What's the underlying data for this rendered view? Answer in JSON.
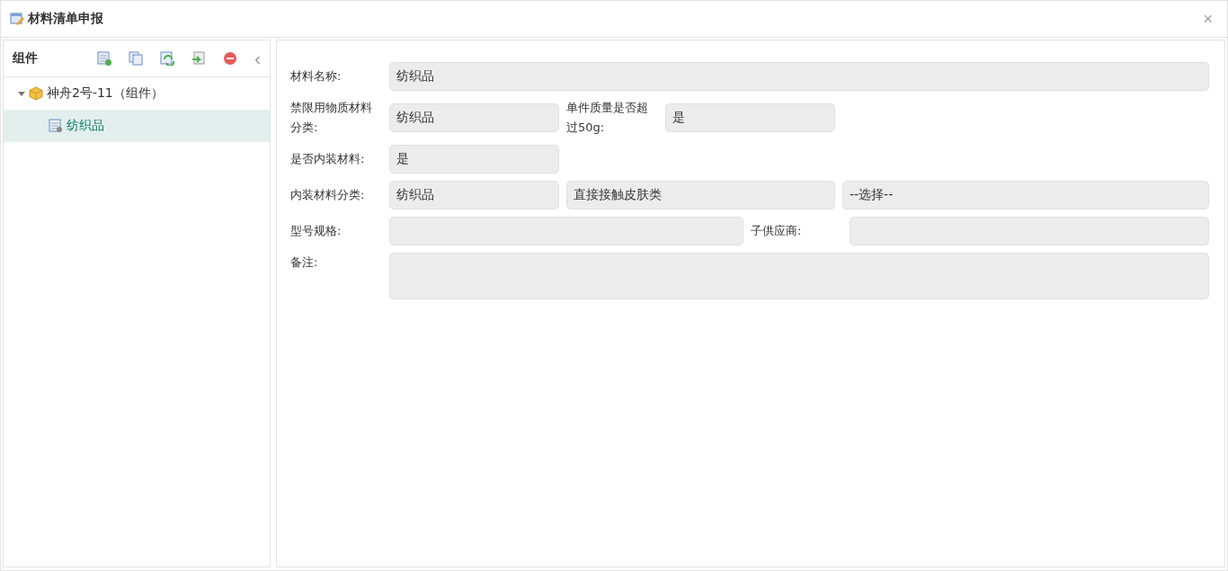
{
  "window": {
    "title": "材料清单申报",
    "close": "×"
  },
  "sidebar": {
    "title": "组件",
    "collapse": "‹",
    "tree": [
      {
        "label": "神舟2号-11（组件）",
        "expanded": true,
        "selected": false,
        "children": [
          {
            "label": "纺织品",
            "selected": true
          }
        ]
      }
    ]
  },
  "form": {
    "material_name": {
      "label": "材料名称:",
      "value": "纺织品"
    },
    "restricted_category": {
      "label": "禁限用物质材料分类:",
      "value": "纺织品"
    },
    "over_50g": {
      "label": "单件质量是否超过50g:",
      "value": "是"
    },
    "inner_material": {
      "label": "是否内装材料:",
      "value": "是"
    },
    "inner_category": {
      "label": "内装材料分类:",
      "values": [
        "纺织品",
        "直接接触皮肤类",
        "--选择--"
      ]
    },
    "model_spec": {
      "label": "型号规格:"
    },
    "sub_supplier": {
      "label": "子供应商:"
    },
    "remarks": {
      "label": "备注:"
    }
  }
}
